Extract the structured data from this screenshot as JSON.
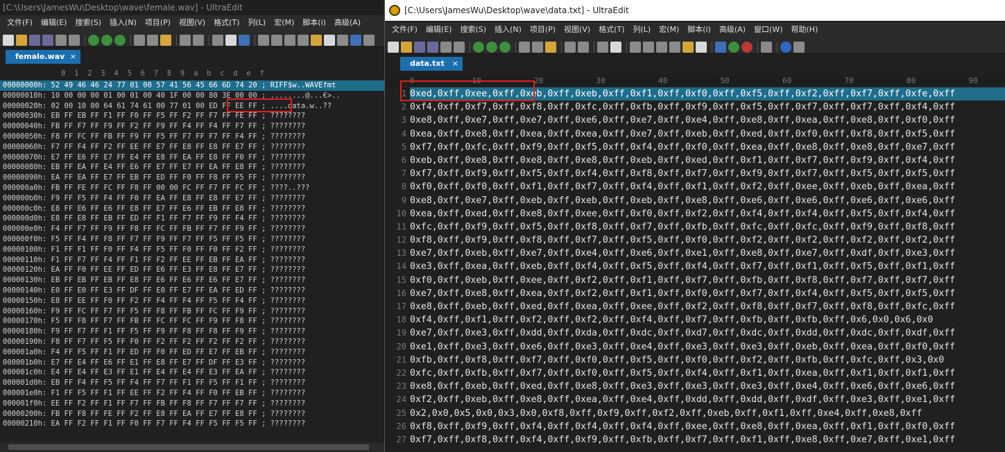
{
  "left": {
    "title": "[C:\\Users\\JamesWu\\Desktop\\wave\\female.wav] - UltraEdit",
    "menu": [
      "文件(F)",
      "编辑(E)",
      "搜索(S)",
      "插入(N)",
      "项目(P)",
      "视图(V)",
      "格式(T)",
      "列(L)",
      "宏(M)",
      "脚本(i)",
      "高级(A)"
    ],
    "tab": {
      "label": "female.wav",
      "close": "×"
    },
    "columns": [
      "0",
      "1",
      "2",
      "3",
      "4",
      "5",
      "6",
      "7",
      "8",
      "9",
      "a",
      "b",
      "c",
      "d",
      "e",
      "f"
    ],
    "rows": [
      "00000000h: 52 49 46 46 24 77 01 00 57 41 56 45 66 6D 74 20 ; RIFF$w..WAVEfmt",
      "00000010h: 10 00 00 00 01 00 01 00 40 1F 00 00 80 3E 00 00 ; ........@...€>..",
      "00000020h: 02 00 10 00 64 61 74 61 00 77 01 00 ED FF EE FF ; ....data.w..??",
      "00000030h: EB FF EB FF F1 FF F0 FF F5 FF F2 FF F7 FF FE FF ; ????????",
      "00000040h: FB FF F7 FF F9 FF F2 FF F9 FF F4 FF F4 FF F7 FF ; ????????",
      "00000050h: F8 FF FC FF FB FF F9 FF F5 FF F7 FF F7 FF F4 FF ; ????????",
      "00000060h: F7 FF F4 FF F2 FF EE FF E7 FF E8 FF E8 FF E7 FF ; ????????",
      "00000070h: E7 FF E6 FF E7 FF E4 FF E8 FF EA FF E8 FF F0 FF ; ????????",
      "00000080h: EB FF EA FF E4 FF E6 FF E7 FF E7 FF EA FF E8 FF ; ????????",
      "00000090h: EA FF EA FF E7 FF EB FF ED FF F0 FF F8 FF F5 FF ; ????????",
      "000000a0h: FB FF FE FF FC FF F8 FF 00 00 FC FF F7 FF FC FF ; ????..???",
      "000000b0h: F9 FF F5 FF F4 FF F0 FF EA FF E8 FF E8 FF E7 FF ; ????????",
      "000000c0h: E8 FF E6 FF E6 FF E8 FF E7 FF E6 FF EB FF E8 FF ; ????????",
      "000000d0h: E8 FF E8 FF EB FF ED FF F1 FF F7 FF F9 FF F4 FF ; ????????",
      "000000e0h: F4 FF F7 FF F9 FF F8 FF FC FF FB FF F7 FF F9 FF ; ????????",
      "000000f0h: F5 FF F4 FF F8 FF F7 FF F9 FF F7 FF F5 FF F5 FF ; ????????",
      "00000100h: F1 FF F1 FF F0 FF F4 FF F5 FF F0 FF F0 FF F2 FF ; ????????",
      "00000110h: F1 FF F7 FF F4 FF F1 FF F2 FF EE FF EB FF EA FF ; ????????",
      "00000120h: EA FF F0 FF EE FF ED FF E6 FF E3 FF E8 FF E7 FF ; ????????",
      "00000130h: EB FF EB FF EB FF E8 FF E6 FF E6 FF E6 FF E7 FF ; ????????",
      "00000140h: E0 FF E0 FF E3 FF DF FF E0 FF E7 FF EA FF ED FF ; ????????",
      "00000150h: E8 FF EE FF F0 FF F2 FF F4 FF F4 FF F5 FF F4 FF ; ????????",
      "00000160h: F9 FF FC FF F7 FF F5 FF F8 FF FB FF FC FF F9 FF ; ????????",
      "00000170h: F5 FF F8 FF F7 FF FB FF FC FF FC FF F9 FF F8 FF ; ????????",
      "00000180h: F9 FF F7 FF F1 FF F5 FF F9 FF F8 FF F8 FF F9 FF ; ????????",
      "00000190h: F8 FF F7 FF F5 FF F0 FF F2 FF F2 FF F2 FF F2 FF ; ????????",
      "000001a0h: F4 FF F5 FF F1 FF ED FF F0 FF ED FF E7 FF EB FF ; ????????",
      "000001b0h: E7 FF E4 FF E6 FF E1 FF E8 FF E7 FF DF FF E3 FF ; ????????",
      "000001c0h: E4 FF E4 FF E3 FF E1 FF E4 FF E4 FF E3 FF EA FF ; ????????",
      "000001d0h: EB FF F4 FF F5 FF F4 FF F7 FF F1 FF F5 FF F1 FF ; ????????",
      "000001e0h: F1 FF F5 FF F1 FF EE FF F2 FF F4 FF F0 FF EB FF ; ????????",
      "000001f0h: EE FF F2 FF F1 FF F7 FF FB FF F8 FF F7 FF F7 FF ; ????????",
      "00000200h: FB FF F8 FF FE FF F2 FF E8 FF EA FF E7 FF E8 FF ; ????????",
      "00000210h: EA FF F2 FF F1 FF F0 FF F7 FF F4 FF F5 FF F5 FF ; ????????"
    ]
  },
  "right": {
    "title": "[C:\\Users\\JamesWu\\Desktop\\wave\\data.txt] - UltraEdit",
    "menu": [
      "文件(F)",
      "编辑(E)",
      "搜索(S)",
      "插入(N)",
      "项目(P)",
      "视图(V)",
      "格式(T)",
      "列(L)",
      "宏(M)",
      "脚本(i)",
      "高级(A)",
      "窗口(W)",
      "帮助(H)"
    ],
    "tab": {
      "label": "data.txt",
      "close": "×"
    },
    "ruler": [
      "0",
      "10",
      "20",
      "30",
      "40",
      "50",
      "60",
      "70",
      "80",
      "90"
    ],
    "lines": [
      "0xed,0xff,0xee,0xff,0xeb,0xff,0xeb,0xff,0xf1,0xff,0xf0,0xff,0xf5,0xff,0xf2,0xff,0xf7,0xff,0xfe,0xff",
      "0xf4,0xff,0xf7,0xff,0xf8,0xff,0xfc,0xff,0xfb,0xff,0xf9,0xff,0xf5,0xff,0xf7,0xff,0xf7,0xff,0xf4,0xff",
      "0xe8,0xff,0xe7,0xff,0xe7,0xff,0xe6,0xff,0xe7,0xff,0xe4,0xff,0xe8,0xff,0xea,0xff,0xe8,0xff,0xf0,0xff",
      "0xea,0xff,0xe8,0xff,0xea,0xff,0xea,0xff,0xe7,0xff,0xeb,0xff,0xed,0xff,0xf0,0xff,0xf8,0xff,0xf5,0xff",
      "0xf7,0xff,0xfc,0xff,0xf9,0xff,0xf5,0xff,0xf4,0xff,0xf0,0xff,0xea,0xff,0xe8,0xff,0xe8,0xff,0xe7,0xff",
      "0xeb,0xff,0xe8,0xff,0xe8,0xff,0xe8,0xff,0xeb,0xff,0xed,0xff,0xf1,0xff,0xf7,0xff,0xf9,0xff,0xf4,0xff",
      "0xf7,0xff,0xf9,0xff,0xf5,0xff,0xf4,0xff,0xf8,0xff,0xf7,0xff,0xf9,0xff,0xf7,0xff,0xf5,0xff,0xf5,0xff",
      "0xf0,0xff,0xf0,0xff,0xf1,0xff,0xf7,0xff,0xf4,0xff,0xf1,0xff,0xf2,0xff,0xee,0xff,0xeb,0xff,0xea,0xff",
      "0xe8,0xff,0xe7,0xff,0xeb,0xff,0xeb,0xff,0xeb,0xff,0xe8,0xff,0xe6,0xff,0xe6,0xff,0xe6,0xff,0xe6,0xff",
      "0xea,0xff,0xed,0xff,0xe8,0xff,0xee,0xff,0xf0,0xff,0xf2,0xff,0xf4,0xff,0xf4,0xff,0xf5,0xff,0xf4,0xff",
      "0xfc,0xff,0xf9,0xff,0xf5,0xff,0xf8,0xff,0xf7,0xff,0xfb,0xff,0xfc,0xff,0xfc,0xff,0xf9,0xff,0xf8,0xff",
      "0xf8,0xff,0xf9,0xff,0xf8,0xff,0xf7,0xff,0xf5,0xff,0xf0,0xff,0xf2,0xff,0xf2,0xff,0xf2,0xff,0xf2,0xff",
      "0xe7,0xff,0xeb,0xff,0xe7,0xff,0xe4,0xff,0xe6,0xff,0xe1,0xff,0xe8,0xff,0xe7,0xff,0xdf,0xff,0xe3,0xff",
      "0xe3,0xff,0xea,0xff,0xeb,0xff,0xf4,0xff,0xf5,0xff,0xf4,0xff,0xf7,0xff,0xf1,0xff,0xf5,0xff,0xf1,0xff",
      "0xf0,0xff,0xeb,0xff,0xee,0xff,0xf2,0xff,0xf1,0xff,0xf7,0xff,0xfb,0xff,0xf8,0xff,0xf7,0xff,0xf7,0xff",
      "0xe7,0xff,0xe8,0xff,0xea,0xff,0xf2,0xff,0xf1,0xff,0xf0,0xff,0xf7,0xff,0xf4,0xff,0xf5,0xff,0xf5,0xff",
      "0xe8,0xff,0xeb,0xff,0xed,0xff,0xea,0xff,0xee,0xff,0xf2,0xff,0xf8,0xff,0xf7,0xff,0xf8,0xff,0xfc,0xff",
      "0xf4,0xff,0xf1,0xff,0xf2,0xff,0xf2,0xff,0xf4,0xff,0xf7,0xff,0xfb,0xff,0xfb,0xff,0x6,0x0,0x6,0x0",
      "0xe7,0xff,0xe3,0xff,0xdd,0xff,0xda,0xff,0xdc,0xff,0xd7,0xff,0xdc,0xff,0xdd,0xff,0xdc,0xff,0xdf,0xff",
      "0xe1,0xff,0xe3,0xff,0xe6,0xff,0xe3,0xff,0xe4,0xff,0xe3,0xff,0xe3,0xff,0xeb,0xff,0xea,0xff,0xf0,0xff",
      "0xfb,0xff,0xf8,0xff,0xf7,0xff,0xf0,0xff,0xf5,0xff,0xf0,0xff,0xf2,0xff,0xfb,0xff,0xfc,0xff,0x3,0x0",
      "0xfc,0xff,0xfb,0xff,0xf7,0xff,0xf0,0xff,0xf5,0xff,0xf4,0xff,0xf1,0xff,0xea,0xff,0xf1,0xff,0xf1,0xff",
      "0xe8,0xff,0xeb,0xff,0xed,0xff,0xe8,0xff,0xe3,0xff,0xe3,0xff,0xe3,0xff,0xe4,0xff,0xe6,0xff,0xe6,0xff",
      "0xf2,0xff,0xeb,0xff,0xe8,0xff,0xea,0xff,0xe4,0xff,0xdd,0xff,0xdd,0xff,0xdf,0xff,0xe3,0xff,0xe1,0xff",
      "0x2,0x0,0x5,0x0,0x3,0x0,0xf8,0xff,0xf9,0xff,0xf2,0xff,0xeb,0xff,0xf1,0xff,0xe4,0xff,0xe8,0xff",
      "0xf8,0xff,0xf9,0xff,0xf4,0xff,0xf4,0xff,0xf4,0xff,0xee,0xff,0xe8,0xff,0xea,0xff,0xf1,0xff,0xf0,0xff",
      "0xf7,0xff,0xf8,0xff,0xf4,0xff,0xf9,0xff,0xfb,0xff,0xf7,0xff,0xf1,0xff,0xe8,0xff,0xe7,0xff,0xe1,0xff"
    ]
  }
}
